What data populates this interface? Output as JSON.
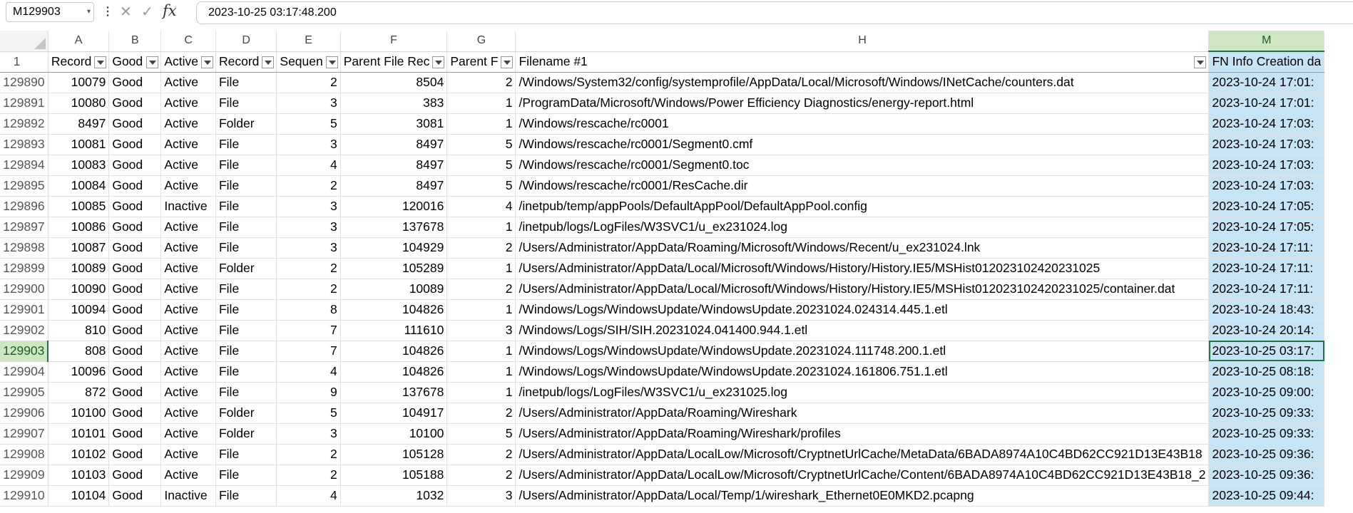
{
  "formula_bar": {
    "name_box": "M129903",
    "more_icon": "vertical-ellipsis",
    "formula": "2023-10-25 03:17:48.200"
  },
  "colors": {
    "selection_green": "#217346",
    "column_fill": "#c7e4f5",
    "header_highlight": "#cfe6c4"
  },
  "columns": [
    "A",
    "B",
    "C",
    "D",
    "E",
    "F",
    "G",
    "H",
    "M"
  ],
  "selected_column": "M",
  "header_row": {
    "row_number": "1",
    "cells": [
      "Record",
      "Good",
      "Active",
      "Record",
      "Sequen",
      "Parent File Rec",
      "Parent F",
      "Filename #1",
      "FN Info Creation da"
    ]
  },
  "rows": [
    {
      "n": "129890",
      "c": [
        "10079",
        "Good",
        "Active",
        "File",
        "2",
        "8504",
        "2",
        "/Windows/System32/config/systemprofile/AppData/Local/Microsoft/Windows/INetCache/counters.dat",
        "2023-10-24 17:01:"
      ]
    },
    {
      "n": "129891",
      "c": [
        "10080",
        "Good",
        "Active",
        "File",
        "3",
        "383",
        "1",
        "/ProgramData/Microsoft/Windows/Power Efficiency Diagnostics/energy-report.html",
        "2023-10-24 17:01:"
      ]
    },
    {
      "n": "129892",
      "c": [
        "8497",
        "Good",
        "Active",
        "Folder",
        "5",
        "3081",
        "1",
        "/Windows/rescache/rc0001",
        "2023-10-24 17:03:"
      ]
    },
    {
      "n": "129893",
      "c": [
        "10081",
        "Good",
        "Active",
        "File",
        "3",
        "8497",
        "5",
        "/Windows/rescache/rc0001/Segment0.cmf",
        "2023-10-24 17:03:"
      ]
    },
    {
      "n": "129894",
      "c": [
        "10083",
        "Good",
        "Active",
        "File",
        "4",
        "8497",
        "5",
        "/Windows/rescache/rc0001/Segment0.toc",
        "2023-10-24 17:03:"
      ]
    },
    {
      "n": "129895",
      "c": [
        "10084",
        "Good",
        "Active",
        "File",
        "2",
        "8497",
        "5",
        "/Windows/rescache/rc0001/ResCache.dir",
        "2023-10-24 17:03:"
      ]
    },
    {
      "n": "129896",
      "c": [
        "10085",
        "Good",
        "Inactive",
        "File",
        "3",
        "120016",
        "4",
        "/inetpub/temp/appPools/DefaultAppPool/DefaultAppPool.config",
        "2023-10-24 17:05:"
      ]
    },
    {
      "n": "129897",
      "c": [
        "10086",
        "Good",
        "Active",
        "File",
        "3",
        "137678",
        "1",
        "/inetpub/logs/LogFiles/W3SVC1/u_ex231024.log",
        "2023-10-24 17:05:"
      ]
    },
    {
      "n": "129898",
      "c": [
        "10087",
        "Good",
        "Active",
        "File",
        "3",
        "104929",
        "2",
        "/Users/Administrator/AppData/Roaming/Microsoft/Windows/Recent/u_ex231024.lnk",
        "2023-10-24 17:11:"
      ]
    },
    {
      "n": "129899",
      "c": [
        "10089",
        "Good",
        "Active",
        "Folder",
        "2",
        "105289",
        "1",
        "/Users/Administrator/AppData/Local/Microsoft/Windows/History/History.IE5/MSHist012023102420231025",
        "2023-10-24 17:11:"
      ]
    },
    {
      "n": "129900",
      "c": [
        "10090",
        "Good",
        "Active",
        "File",
        "2",
        "10089",
        "2",
        "/Users/Administrator/AppData/Local/Microsoft/Windows/History/History.IE5/MSHist012023102420231025/container.dat",
        "2023-10-24 17:11:"
      ]
    },
    {
      "n": "129901",
      "c": [
        "10094",
        "Good",
        "Active",
        "File",
        "8",
        "104826",
        "1",
        "/Windows/Logs/WindowsUpdate/WindowsUpdate.20231024.024314.445.1.etl",
        "2023-10-24 18:43:"
      ]
    },
    {
      "n": "129902",
      "c": [
        "810",
        "Good",
        "Active",
        "File",
        "7",
        "111610",
        "3",
        "/Windows/Logs/SIH/SIH.20231024.041400.944.1.etl",
        "2023-10-24 20:14:"
      ]
    },
    {
      "n": "129903",
      "c": [
        "808",
        "Good",
        "Active",
        "File",
        "7",
        "104826",
        "1",
        "/Windows/Logs/WindowsUpdate/WindowsUpdate.20231024.111748.200.1.etl",
        "2023-10-25 03:17:"
      ]
    },
    {
      "n": "129904",
      "c": [
        "10096",
        "Good",
        "Active",
        "File",
        "4",
        "104826",
        "1",
        "/Windows/Logs/WindowsUpdate/WindowsUpdate.20231024.161806.751.1.etl",
        "2023-10-25 08:18:"
      ]
    },
    {
      "n": "129905",
      "c": [
        "872",
        "Good",
        "Active",
        "File",
        "9",
        "137678",
        "1",
        "/inetpub/logs/LogFiles/W3SVC1/u_ex231025.log",
        "2023-10-25 09:00:"
      ]
    },
    {
      "n": "129906",
      "c": [
        "10100",
        "Good",
        "Active",
        "Folder",
        "5",
        "104917",
        "2",
        "/Users/Administrator/AppData/Roaming/Wireshark",
        "2023-10-25 09:33:"
      ]
    },
    {
      "n": "129907",
      "c": [
        "10101",
        "Good",
        "Active",
        "Folder",
        "3",
        "10100",
        "5",
        "/Users/Administrator/AppData/Roaming/Wireshark/profiles",
        "2023-10-25 09:33:"
      ]
    },
    {
      "n": "129908",
      "c": [
        "10102",
        "Good",
        "Active",
        "File",
        "2",
        "105128",
        "2",
        "/Users/Administrator/AppData/LocalLow/Microsoft/CryptnetUrlCache/MetaData/6BADA8974A10C4BD62CC921D13E43B18",
        "2023-10-25 09:36:"
      ]
    },
    {
      "n": "129909",
      "c": [
        "10103",
        "Good",
        "Active",
        "File",
        "2",
        "105188",
        "2",
        "/Users/Administrator/AppData/LocalLow/Microsoft/CryptnetUrlCache/Content/6BADA8974A10C4BD62CC921D13E43B18_2",
        "2023-10-25 09:36:"
      ]
    },
    {
      "n": "129910",
      "c": [
        "10104",
        "Good",
        "Inactive",
        "File",
        "4",
        "1032",
        "3",
        "/Users/Administrator/AppData/Local/Temp/1/wireshark_Ethernet0E0MKD2.pcapng",
        "2023-10-25 09:44:"
      ]
    }
  ],
  "active_row": "129903"
}
